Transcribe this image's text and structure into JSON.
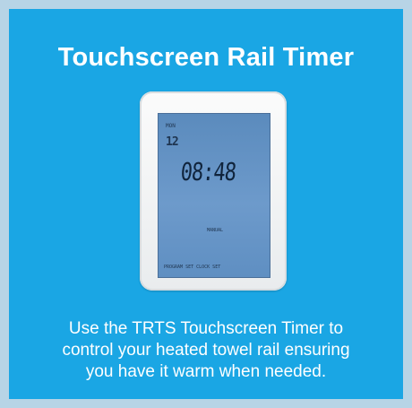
{
  "title": "Touchscreen Rail Timer",
  "device": {
    "screen": {
      "day_text": "MON",
      "program_text": "12",
      "time": "08:48",
      "mode_text": "MANUAL",
      "bottom_text": "PROGRAM SET CLOCK SET"
    }
  },
  "caption": {
    "line1": "Use the TRTS Touchscreen Timer to",
    "line2": "control your heated towel rail ensuring",
    "line3": "you have it warm when needed."
  },
  "colors": {
    "background": "#1aa6e4",
    "border": "#b7d4e6",
    "text": "#ffffff",
    "screen": "#6d9acb"
  }
}
